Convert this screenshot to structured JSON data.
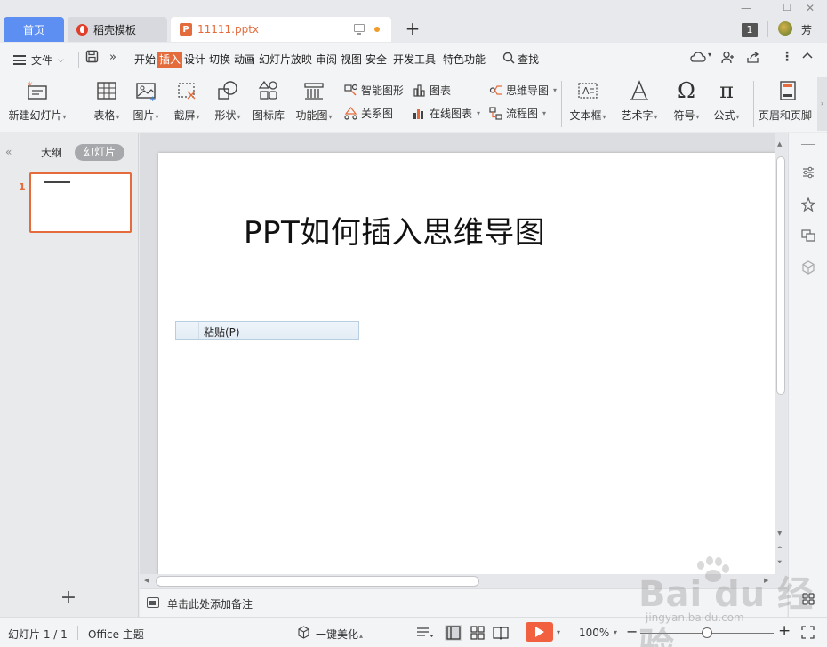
{
  "tabs": {
    "home": "首页",
    "template": "稻壳模板",
    "file": "11111.pptx",
    "account_count": "1",
    "user_name": "芳"
  },
  "menu": {
    "file": "文件",
    "tabs": [
      "开始",
      "插入",
      "设计",
      "切换",
      "动画",
      "幻灯片放映",
      "审阅",
      "视图",
      "安全",
      "开发工具",
      "特色功能"
    ],
    "active_tab": "插入",
    "search": "查找"
  },
  "ribbon": {
    "new_slide": "新建幻灯片",
    "table": "表格",
    "picture": "图片",
    "screenshot": "截屏",
    "shape": "形状",
    "icon_lib": "图标库",
    "function_chart": "功能图",
    "smart_art": "智能图形",
    "chart": "图表",
    "relation": "关系图",
    "online_chart": "在线图表",
    "mind_map": "思维导图",
    "flowchart": "流程图",
    "textbox": "文本框",
    "wordart": "艺术字",
    "symbol": "符号",
    "formula": "公式",
    "header_footer": "页眉和页脚"
  },
  "left_panel": {
    "outline_tab": "大纲",
    "slides_tab": "幻灯片",
    "slide_number": "1"
  },
  "slide": {
    "title": "PPT如何插入思维导图"
  },
  "context_menu": {
    "paste": "粘贴(P)"
  },
  "notes": {
    "placeholder": "单击此处添加备注"
  },
  "status": {
    "slide_counter": "幻灯片 1 / 1",
    "theme": "Office 主题",
    "beautify": "一键美化",
    "zoom": "100%"
  },
  "watermark": {
    "main": "Bai du 经验",
    "sub": "jingyan.baidu.com"
  },
  "colors": {
    "accent": "#e46b3b",
    "home_tab": "#5d8ef2",
    "play": "#f2613f"
  }
}
